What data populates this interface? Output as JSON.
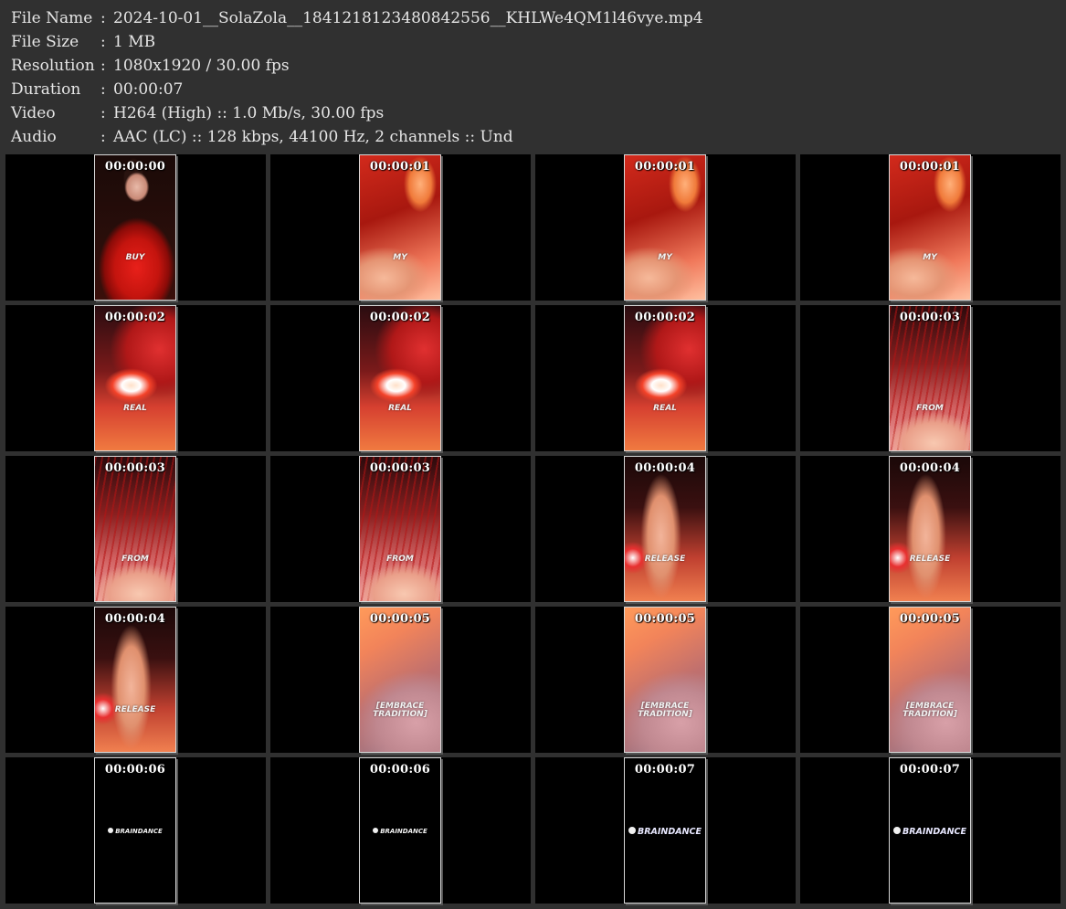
{
  "file_info": {
    "rows": [
      {
        "label": "File Name",
        "sep": ":",
        "value": "2024-10-01__SolaZola__1841218123480842556__KHLWe4QM1l46vye.mp4"
      },
      {
        "label": "File Size",
        "sep": ":",
        "value": "1 MB"
      },
      {
        "label": "Resolution",
        "sep": ":",
        "value": "1080x1920 / 30.00 fps"
      },
      {
        "label": "Duration",
        "sep": ":",
        "value": "00:00:07"
      },
      {
        "label": "Video",
        "sep": ":",
        "value": "H264 (High) :: 1.0 Mb/s, 30.00 fps"
      },
      {
        "label": "Audio",
        "sep": ":",
        "value": "AAC (LC) :: 128 kbps, 44100 Hz, 2 channels :: Und"
      }
    ]
  },
  "thumbnails": [
    {
      "time": "00:00:00",
      "scene": "woman",
      "caption": "BUY",
      "logo": "",
      "logo_big": false
    },
    {
      "time": "00:00:01",
      "scene": "red",
      "caption": "MY",
      "logo": "",
      "logo_big": false
    },
    {
      "time": "00:00:01",
      "scene": "red",
      "caption": "MY",
      "logo": "",
      "logo_big": false
    },
    {
      "time": "00:00:01",
      "scene": "red",
      "caption": "MY",
      "logo": "",
      "logo_big": false
    },
    {
      "time": "00:00:02",
      "scene": "sushi",
      "caption": "REAL",
      "logo": "",
      "logo_big": false
    },
    {
      "time": "00:00:02",
      "scene": "sushi",
      "caption": "REAL",
      "logo": "",
      "logo_big": false
    },
    {
      "time": "00:00:02",
      "scene": "sushi",
      "caption": "REAL",
      "logo": "",
      "logo_big": false
    },
    {
      "time": "00:00:03",
      "scene": "from",
      "caption": "FROM",
      "logo": "",
      "logo_big": false
    },
    {
      "time": "00:00:03",
      "scene": "from",
      "caption": "FROM",
      "logo": "",
      "logo_big": false
    },
    {
      "time": "00:00:03",
      "scene": "from",
      "caption": "FROM",
      "logo": "",
      "logo_big": false
    },
    {
      "time": "00:00:04",
      "scene": "release",
      "caption": "RELEASE",
      "logo": "",
      "logo_big": false
    },
    {
      "time": "00:00:04",
      "scene": "release",
      "caption": "RELEASE",
      "logo": "",
      "logo_big": false
    },
    {
      "time": "00:00:04",
      "scene": "release",
      "caption": "RELEASE",
      "logo": "",
      "logo_big": false
    },
    {
      "time": "00:00:05",
      "scene": "skin",
      "caption": "[EMBRACE\nTRADITION]",
      "logo": "",
      "logo_big": false
    },
    {
      "time": "00:00:05",
      "scene": "skin",
      "caption": "[EMBRACE\nTRADITION]",
      "logo": "",
      "logo_big": false
    },
    {
      "time": "00:00:05",
      "scene": "skin",
      "caption": "[EMBRACE\nTRADITION]",
      "logo": "",
      "logo_big": false
    },
    {
      "time": "00:00:06",
      "scene": "black",
      "caption": "",
      "logo": "BRAINDANCE",
      "logo_big": false
    },
    {
      "time": "00:00:06",
      "scene": "black",
      "caption": "",
      "logo": "BRAINDANCE",
      "logo_big": false
    },
    {
      "time": "00:00:07",
      "scene": "black",
      "caption": "",
      "logo": "BRAINDANCE",
      "logo_big": true
    },
    {
      "time": "00:00:07",
      "scene": "black",
      "caption": "",
      "logo": "BRAINDANCE",
      "logo_big": true
    }
  ]
}
